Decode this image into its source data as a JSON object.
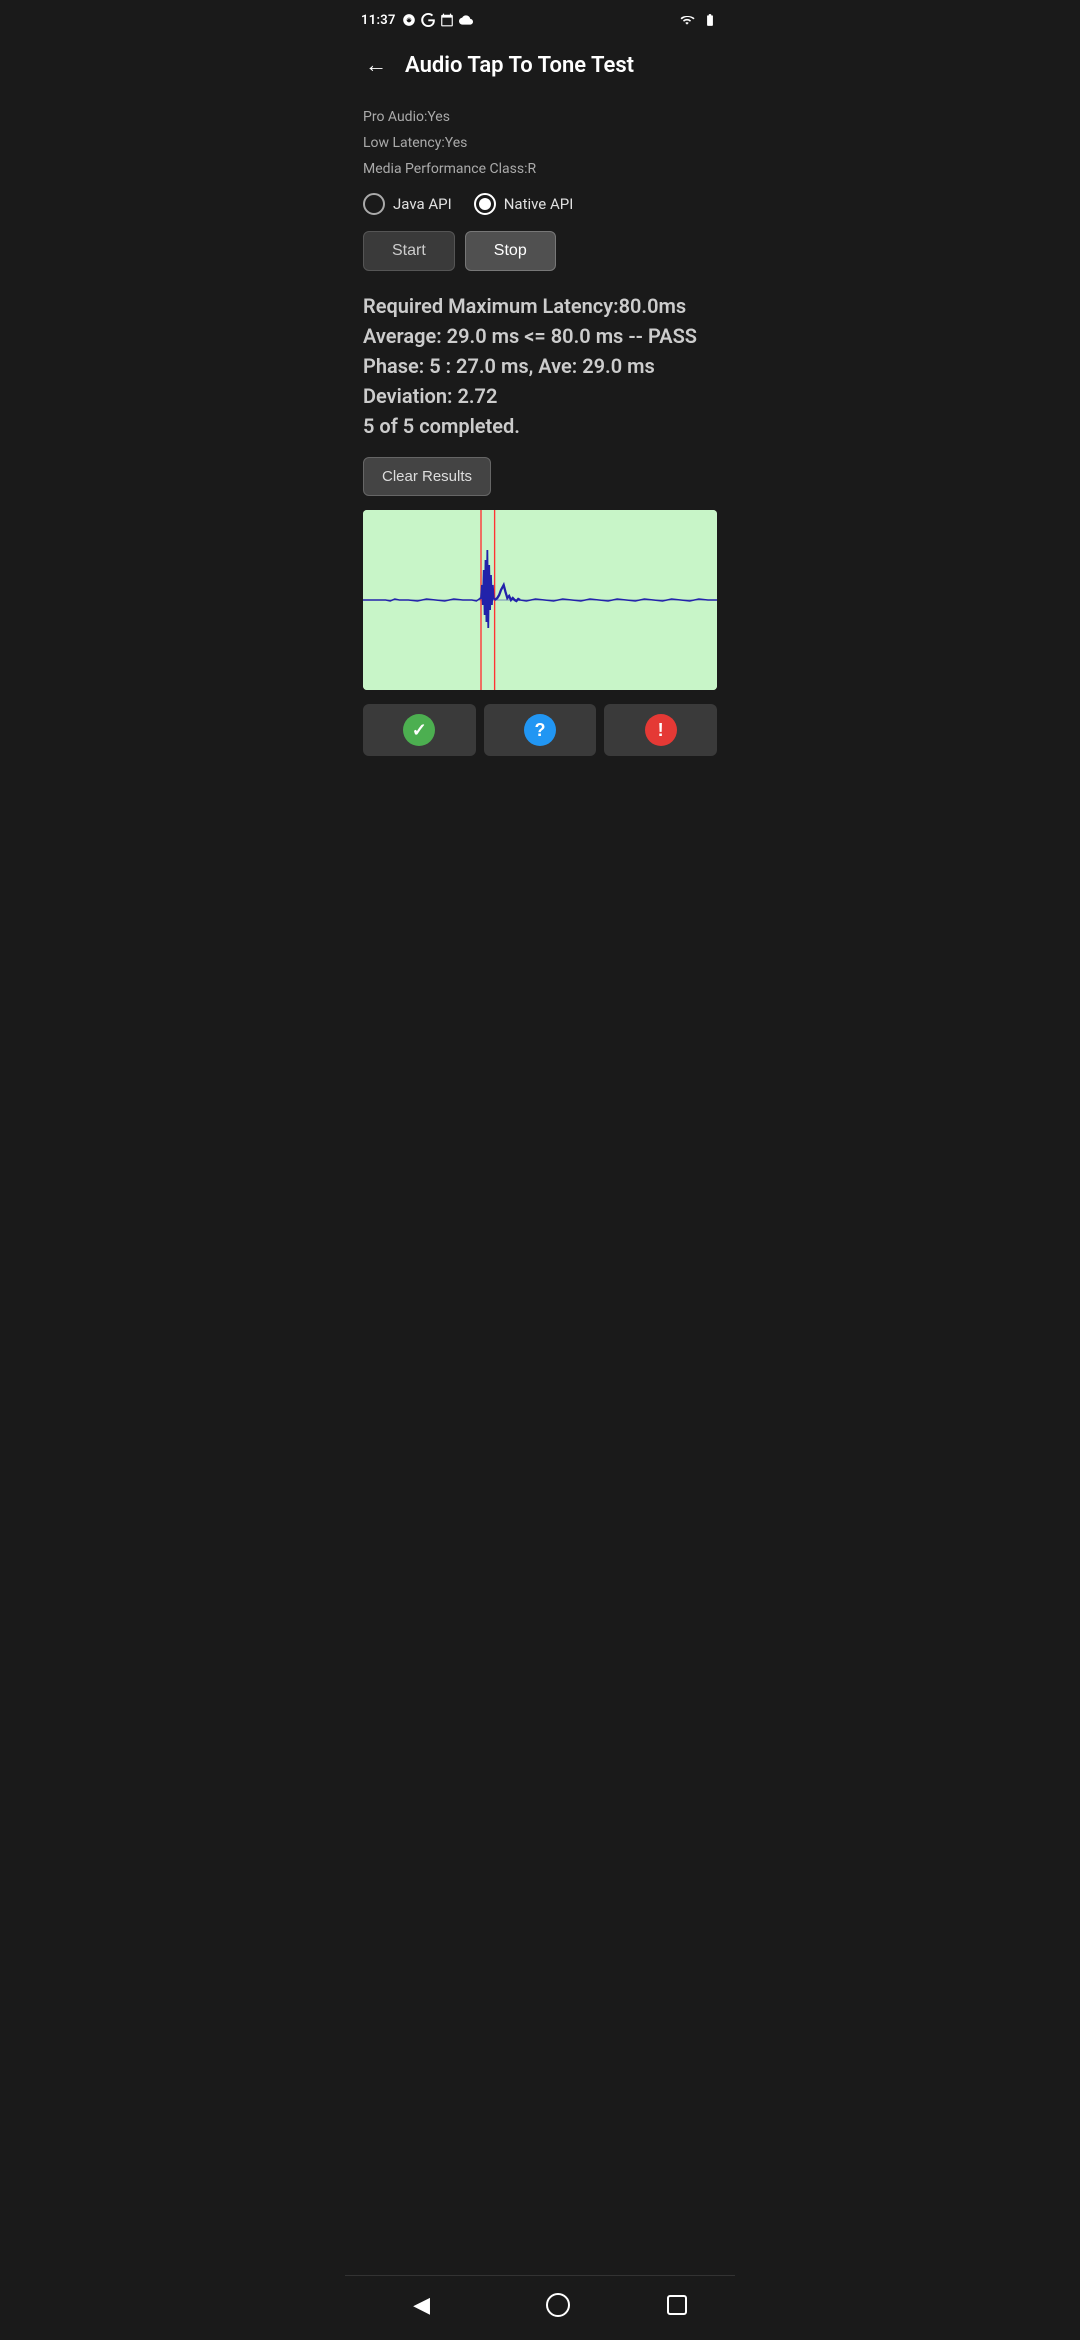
{
  "statusBar": {
    "time": "11:37",
    "icons": [
      "fan",
      "google",
      "calendar",
      "cloud"
    ],
    "wifi": "wifi",
    "battery": "battery"
  },
  "appBar": {
    "backLabel": "←",
    "title": "Audio Tap To Tone Test"
  },
  "deviceInfo": {
    "proAudio": "Pro Audio:Yes",
    "lowLatency": "Low Latency:Yes",
    "mediaPerformance": "Media Performance Class:R"
  },
  "apiSelector": {
    "javaLabel": "Java API",
    "nativeLabel": "Native API",
    "selected": "native"
  },
  "buttons": {
    "startLabel": "Start",
    "stopLabel": "Stop"
  },
  "results": {
    "line1": "Required Maximum Latency:80.0ms",
    "line2": "Average: 29.0 ms <= 80.0 ms -- PASS",
    "line3": "Phase: 5 : 27.0 ms, Ave: 29.0 ms",
    "line4": "Deviation: 2.72",
    "line5": "5 of 5 completed."
  },
  "clearButton": {
    "label": "Clear Results"
  },
  "bottomIcons": {
    "pass": "✓",
    "question": "?",
    "warning": "!"
  },
  "navBar": {
    "back": "◀",
    "home": "",
    "recent": ""
  }
}
